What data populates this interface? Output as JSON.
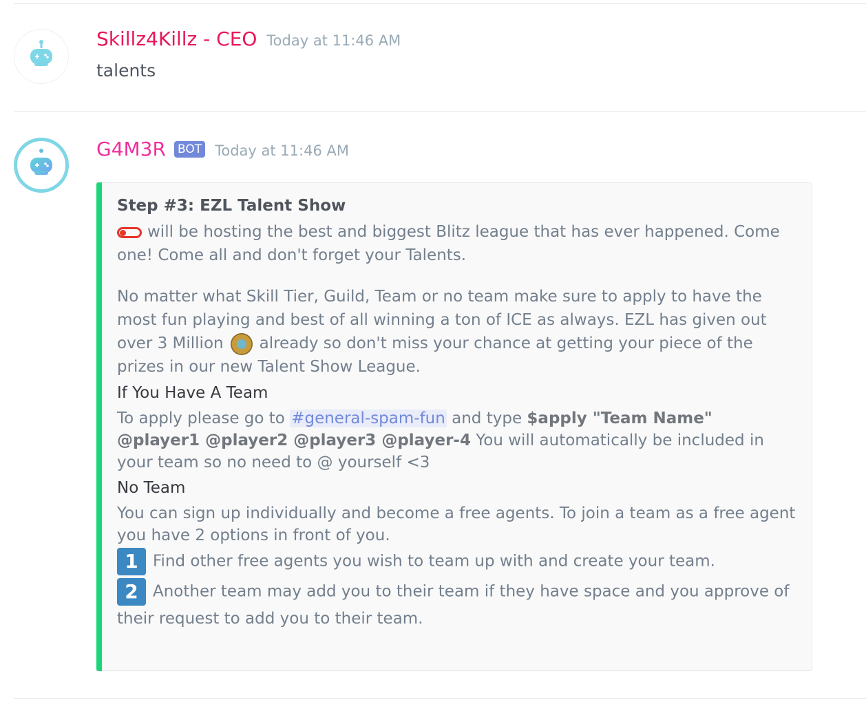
{
  "messages": [
    {
      "author": "Skillz4Killz - CEO",
      "timestamp": "Today at 11:46 AM",
      "text": "talents"
    },
    {
      "author": "G4M3R",
      "bot_tag": "BOT",
      "timestamp": "Today at 11:46 AM"
    }
  ],
  "embed": {
    "title": "Step #3: EZL Talent Show",
    "intro": "will be hosting the best and biggest Blitz league that has ever happened. Come one! Come all and don't forget your Talents.",
    "para2_before": "No matter what Skill Tier, Guild, Team or no team make sure to apply to have the most fun playing and best of all winning a ton of ICE as always. EZL has given out over 3 Million",
    "para2_after": "already so don't miss your chance at getting your piece of the prizes in our new Talent Show League.",
    "fields": [
      {
        "name": "If You Have A Team",
        "prefix": "To apply please go to",
        "channel": "#general-spam-fun",
        "mid": "and type",
        "command": "$apply \"Team Name\" @player1 @player2 @player3 @player-4",
        "suffix": "You will automatically be included in your team so no need to @ yourself <3"
      },
      {
        "name": "No Team",
        "text": "You can sign up individually and become a free agents. To join a team as a free agent you have 2 options in front of you.",
        "options": [
          {
            "key": "1",
            "text": "Find other free agents you wish to team up with and create your team."
          },
          {
            "key": "2",
            "text": "Another team may add you to their team if they have space and you approve of their request to add you to their team."
          }
        ]
      }
    ]
  },
  "colors": {
    "embed_bar": "#1ed67a",
    "author1": "#e6185a",
    "author2": "#ef2f9c",
    "bot_tag": "#7289da",
    "mention": "#7289da"
  },
  "icons": {
    "avatar": "robot-gamepad-icon",
    "toggle": "toggle-off-icon",
    "ice": "ice-coin-icon",
    "keycap": "keycap-number-icon"
  }
}
